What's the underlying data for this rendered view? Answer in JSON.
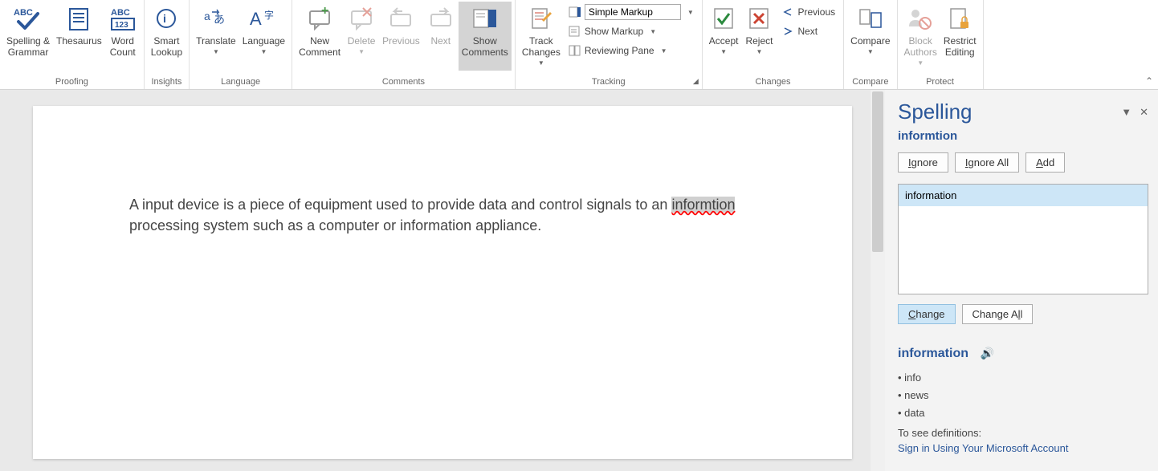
{
  "ribbon": {
    "groups": {
      "proofing": {
        "label": "Proofing",
        "spelling_grammar": "Spelling &\nGrammar",
        "thesaurus": "Thesaurus",
        "word_count": "Word\nCount"
      },
      "insights": {
        "label": "Insights",
        "smart_lookup": "Smart\nLookup"
      },
      "language": {
        "label": "Language",
        "translate": "Translate",
        "language": "Language"
      },
      "comments": {
        "label": "Comments",
        "new_comment": "New\nComment",
        "delete": "Delete",
        "previous": "Previous",
        "next": "Next",
        "show_comments": "Show\nComments"
      },
      "tracking": {
        "label": "Tracking",
        "track_changes": "Track\nChanges",
        "markup_value": "Simple Markup",
        "show_markup": "Show Markup",
        "reviewing_pane": "Reviewing Pane"
      },
      "changes": {
        "label": "Changes",
        "accept": "Accept",
        "reject": "Reject",
        "previous": "Previous",
        "next": "Next"
      },
      "compare": {
        "label": "Compare",
        "compare": "Compare"
      },
      "protect": {
        "label": "Protect",
        "block_authors": "Block\nAuthors",
        "restrict_editing": "Restrict\nEditing"
      }
    }
  },
  "document": {
    "text_before": "A input device is a piece of equipment used to provide data and control signals to an ",
    "misspelled": "informtion",
    "text_after": " processing system such as a computer or information appliance."
  },
  "spelling": {
    "title": "Spelling",
    "flagged": "informtion",
    "ignore": "Ignore",
    "ignore_all": "Ignore All",
    "add": "Add",
    "suggestion": "information",
    "change": "Change",
    "change_all": "Change All",
    "def_word": "information",
    "synonyms": [
      "info",
      "news",
      "data"
    ],
    "def_prompt": "To see definitions:",
    "signin": "Sign in Using Your Microsoft Account"
  }
}
